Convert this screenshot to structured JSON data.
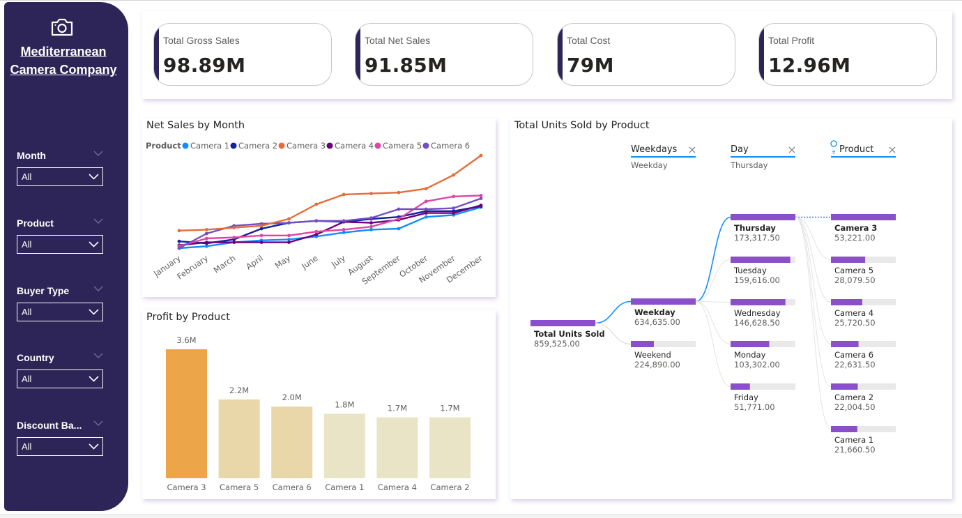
{
  "sidebar": {
    "brand_line1": "Mediterranean",
    "brand_line2": "Camera Company",
    "slicers": [
      {
        "title": "Month",
        "value": "All"
      },
      {
        "title": "Product",
        "value": "All"
      },
      {
        "title": "Buyer Type",
        "value": "All"
      },
      {
        "title": "Country",
        "value": "All"
      },
      {
        "title": "Discount Ba...",
        "value": "All"
      }
    ]
  },
  "kpis": [
    {
      "label": "Total Gross Sales",
      "value": "98.89M"
    },
    {
      "label": "Total Net Sales",
      "value": "91.85M"
    },
    {
      "label": "Total Cost",
      "value": "79M"
    },
    {
      "label": "Total Profit",
      "value": "12.96M"
    }
  ],
  "colors": {
    "sidebar_bg": "#2d2557",
    "camera1": "#118dff",
    "camera2": "#12239e",
    "camera3": "#e66c37",
    "camera4": "#6b007b",
    "camera5": "#e044a7",
    "camera6": "#744ec2",
    "bar_top": "#eda54a",
    "bar_mid": "#e9d7a9",
    "bar_low": "#e9e4c5",
    "tree_bar": "#8a4fc9",
    "tree_track": "#e9e9e9",
    "tree_link_active": "#118dff"
  },
  "line_chart": {
    "title": "Net Sales by Month",
    "legend_title": "Product",
    "chart_data": {
      "type": "line",
      "categories": [
        "January",
        "February",
        "March",
        "April",
        "May",
        "June",
        "July",
        "August",
        "September",
        "October",
        "November",
        "December"
      ],
      "series": [
        {
          "name": "Camera 1",
          "values": [
            0.3,
            0.32,
            0.36,
            0.38,
            0.39,
            0.42,
            0.46,
            0.49,
            0.5,
            0.62,
            0.64,
            0.72
          ]
        },
        {
          "name": "Camera 2",
          "values": [
            0.37,
            0.35,
            0.39,
            0.5,
            0.56,
            0.58,
            0.57,
            0.6,
            0.62,
            0.68,
            0.68,
            0.73
          ]
        },
        {
          "name": "Camera 3",
          "values": [
            0.48,
            0.49,
            0.51,
            0.53,
            0.6,
            0.75,
            0.85,
            0.86,
            0.87,
            0.91,
            1.05,
            1.25
          ]
        },
        {
          "name": "Camera 4",
          "values": [
            0.33,
            0.36,
            0.36,
            0.36,
            0.36,
            0.44,
            0.57,
            0.56,
            0.59,
            0.66,
            0.66,
            0.74
          ]
        },
        {
          "name": "Camera 5",
          "values": [
            0.32,
            0.4,
            0.41,
            0.43,
            0.43,
            0.47,
            0.49,
            0.52,
            0.6,
            0.78,
            0.83,
            0.84
          ]
        },
        {
          "name": "Camera 6",
          "values": [
            0.3,
            0.45,
            0.53,
            0.55,
            0.56,
            0.58,
            0.58,
            0.61,
            0.7,
            0.7,
            0.71,
            0.81
          ]
        }
      ]
    }
  },
  "bar_chart": {
    "title": "Profit by Product",
    "chart_data": {
      "type": "bar",
      "categories": [
        "Camera 3",
        "Camera 5",
        "Camera 6",
        "Camera 1",
        "Camera 4",
        "Camera 2"
      ],
      "values": [
        3.6,
        2.2,
        2.0,
        1.8,
        1.7,
        1.7
      ],
      "labels": [
        "3.6M",
        "2.2M",
        "2.0M",
        "1.8M",
        "1.7M",
        "1.7M"
      ],
      "ylim": [
        0,
        3.6
      ]
    }
  },
  "tree": {
    "title": "Total Units Sold by Product",
    "headers": [
      {
        "name": "Weekdays",
        "sub": "Weekday"
      },
      {
        "name": "Day",
        "sub": "Thursday"
      },
      {
        "name": "Product",
        "sub": ""
      }
    ],
    "root": {
      "label": "Total Units Sold",
      "value": "859,525.00",
      "amount": 859525
    },
    "level1": [
      {
        "label": "Weekday",
        "value": "634,635.00",
        "amount": 634635,
        "selected": true
      },
      {
        "label": "Weekend",
        "value": "224,890.00",
        "amount": 224890,
        "selected": false
      }
    ],
    "level2": [
      {
        "label": "Thursday",
        "value": "173,317.50",
        "amount": 173317.5,
        "selected": true
      },
      {
        "label": "Tuesday",
        "value": "159,616.00",
        "amount": 159616,
        "selected": false
      },
      {
        "label": "Wednesday",
        "value": "146,628.50",
        "amount": 146628.5,
        "selected": false
      },
      {
        "label": "Monday",
        "value": "103,302.00",
        "amount": 103302,
        "selected": false
      },
      {
        "label": "Friday",
        "value": "51,771.00",
        "amount": 51771,
        "selected": false
      }
    ],
    "level3": [
      {
        "label": "Camera 3",
        "value": "53,221.00",
        "amount": 53221,
        "selected": true
      },
      {
        "label": "Camera 5",
        "value": "28,079.50",
        "amount": 28079.5,
        "selected": false
      },
      {
        "label": "Camera 4",
        "value": "25,720.50",
        "amount": 25720.5,
        "selected": false
      },
      {
        "label": "Camera 6",
        "value": "22,631.50",
        "amount": 22631.5,
        "selected": false
      },
      {
        "label": "Camera 2",
        "value": "22,004.50",
        "amount": 22004.5,
        "selected": false
      },
      {
        "label": "Camera 1",
        "value": "21,660.50",
        "amount": 21660.5,
        "selected": false
      }
    ]
  }
}
